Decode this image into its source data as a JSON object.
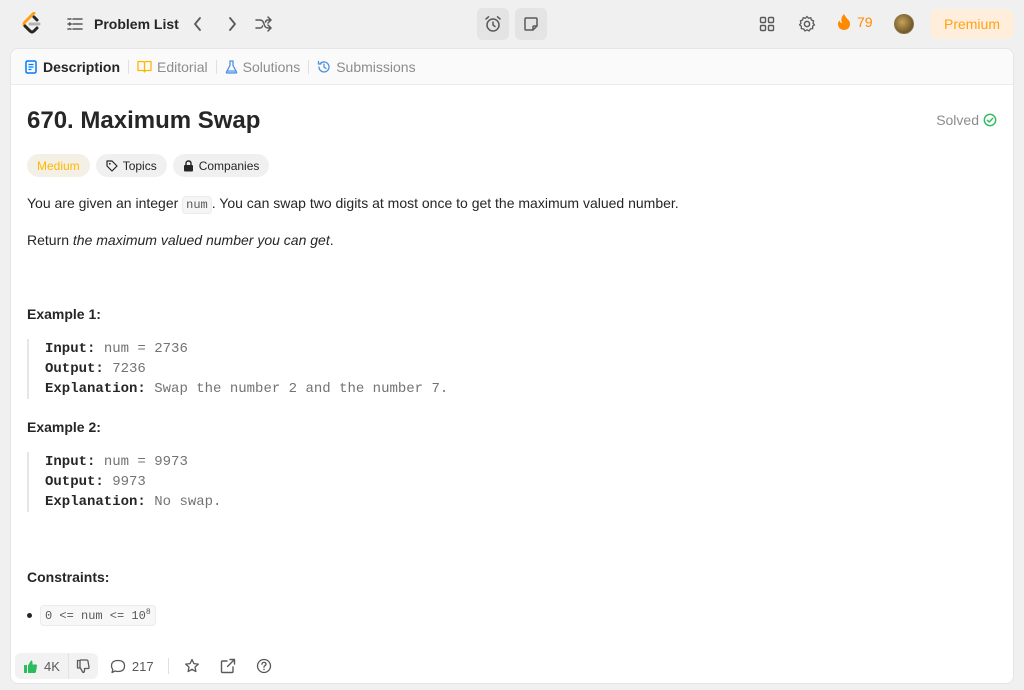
{
  "nav": {
    "problem_list": "Problem List",
    "streak": "79",
    "premium": "Premium"
  },
  "tabs": [
    {
      "label": "Description"
    },
    {
      "label": "Editorial"
    },
    {
      "label": "Solutions"
    },
    {
      "label": "Submissions"
    }
  ],
  "problem": {
    "title": "670. Maximum Swap",
    "status": "Solved",
    "tags": {
      "difficulty": "Medium",
      "topics": "Topics",
      "companies": "Companies"
    },
    "desc_1_before": "You are given an integer ",
    "desc_1_code": "num",
    "desc_1_after": ". You can swap two digits at most once to get the maximum valued number.",
    "desc_2_before": "Return ",
    "desc_2_em": "the maximum valued number you can get",
    "desc_2_after": "."
  },
  "examples": [
    {
      "heading": "Example 1:",
      "input_label": "Input:",
      "input": "num = 2736",
      "output_label": "Output:",
      "output": "7236",
      "explanation_label": "Explanation:",
      "explanation": "Swap the number 2 and the number 7."
    },
    {
      "heading": "Example 2:",
      "input_label": "Input:",
      "input": "num = 9973",
      "output_label": "Output:",
      "output": "9973",
      "explanation_label": "Explanation:",
      "explanation": "No swap."
    }
  ],
  "constraints": {
    "heading": "Constraints:",
    "item": "0 <= num <= 10",
    "item_sup": "8"
  },
  "footer": {
    "likes": "4K",
    "comments": "217"
  },
  "colors": {
    "accent": "#ffa116",
    "medium": "#ffb800",
    "solved": "#2cbb5d",
    "like": "#2cbb5d"
  }
}
